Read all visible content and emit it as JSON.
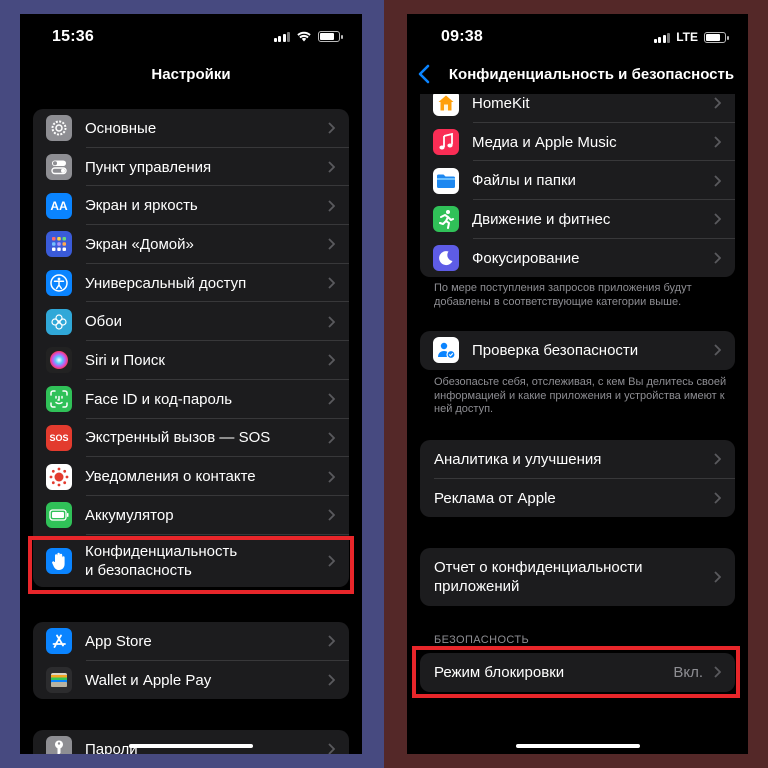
{
  "left": {
    "status": {
      "time": "15:36"
    },
    "title": "Настройки",
    "groups": [
      {
        "items": [
          {
            "label": "Основные",
            "icon": "gear-icon",
            "color": "#8e8e93"
          },
          {
            "label": "Пункт управления",
            "icon": "toggles-icon",
            "color": "#8e8e93"
          },
          {
            "label": "Экран и яркость",
            "icon": "text-size-icon",
            "color": "#0a84ff"
          },
          {
            "label": "Экран «Домой»",
            "icon": "home-grid-icon",
            "color": "#3a5bd9"
          },
          {
            "label": "Универсальный доступ",
            "icon": "accessibility-icon",
            "color": "#0a84ff"
          },
          {
            "label": "Обои",
            "icon": "flower-icon",
            "color": "#30a8d8"
          },
          {
            "label": "Siri и Поиск",
            "icon": "siri-icon",
            "color": "#222222"
          },
          {
            "label": "Face ID и код-пароль",
            "icon": "face-id-icon",
            "color": "#30c158"
          },
          {
            "label": "Экстренный вызов — SOS",
            "icon": "sos-icon",
            "color": "#e33b2e"
          },
          {
            "label": "Уведомления о контакте",
            "icon": "exposure-icon",
            "color": "#ffffff"
          },
          {
            "label": "Аккумулятор",
            "icon": "battery-icon",
            "color": "#30c158"
          },
          {
            "label_line1": "Конфиденциальность",
            "label_line2": "и безопасность",
            "icon": "hand-icon",
            "color": "#0a84ff"
          }
        ]
      },
      {
        "items": [
          {
            "label": "App Store",
            "icon": "app-store-icon",
            "color": "#0a84ff"
          },
          {
            "label": "Wallet и Apple Pay",
            "icon": "wallet-icon",
            "color": "#2c2c2e"
          }
        ]
      },
      {
        "items": [
          {
            "label": "Пароли",
            "icon": "key-icon",
            "color": "#8e8e93"
          }
        ]
      }
    ]
  },
  "right": {
    "status": {
      "time": "09:38",
      "network": "LTE"
    },
    "title": "Конфиденциальность и безопасность",
    "apps": [
      {
        "label": "HomeKit",
        "icon": "home-icon",
        "color": "#ff9f0a"
      },
      {
        "label": "Медиа и Apple Music",
        "icon": "music-icon",
        "color": "#fa2d55"
      },
      {
        "label": "Файлы и папки",
        "icon": "folder-icon",
        "color": "#1e88f0"
      },
      {
        "label": "Движение и фитнес",
        "icon": "fitness-icon",
        "color": "#30c158"
      },
      {
        "label": "Фокусирование",
        "icon": "moon-icon",
        "color": "#5e5ce6"
      }
    ],
    "apps_note": "По мере поступления запросов приложения будут добавлены в соответствующие категории выше.",
    "safety_check": {
      "label": "Проверка безопасности",
      "icon": "safety-check-icon",
      "color": "#0a84ff"
    },
    "safety_note": "Обезопасьте себя, отслеживая, с кем Вы делитесь своей информацией и какие приложения и устройства имеют к ней доступ.",
    "analytics": [
      {
        "label": "Аналитика и улучшения"
      },
      {
        "label": "Реклама от Apple"
      }
    ],
    "report": {
      "line1": "Отчет о конфиденциальности",
      "line2": "приложений"
    },
    "security_header": "БЕЗОПАСНОСТЬ",
    "lockdown": {
      "label": "Режим блокировки",
      "value": "Вкл."
    }
  },
  "colors": {
    "highlight": "#e8262a",
    "cell": "#1c1c1e",
    "secondary_text": "#8e8e93"
  }
}
